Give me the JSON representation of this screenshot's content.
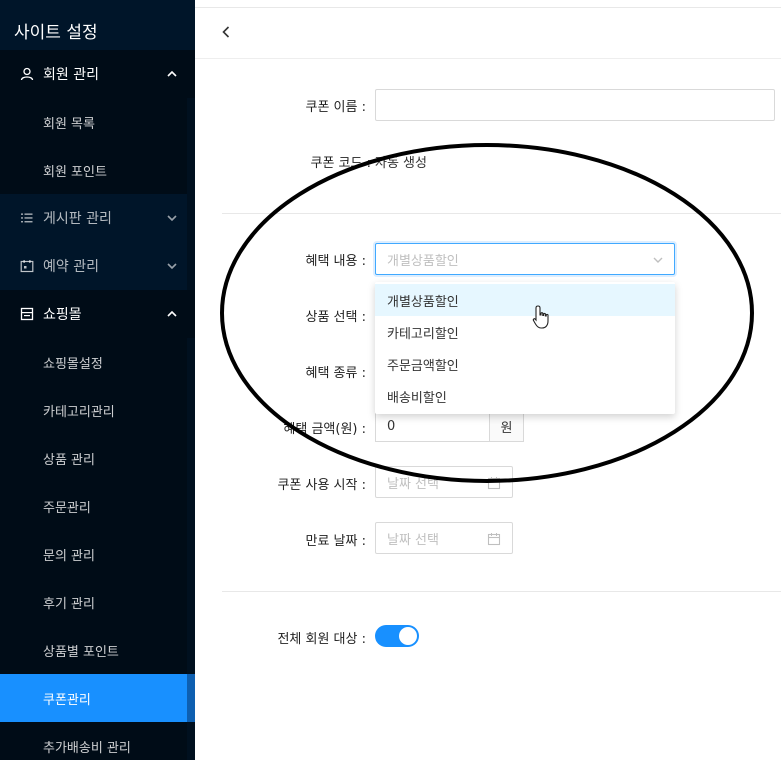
{
  "sidebar": {
    "title": "사이트 설정",
    "menus": [
      {
        "label": "회원 관리",
        "icon": "user-icon",
        "expanded": true
      },
      {
        "label": "회원 목록"
      },
      {
        "label": "회원 포인트"
      },
      {
        "label": "게시판 관리",
        "icon": "list-icon",
        "expanded": false
      },
      {
        "label": "예약 관리",
        "icon": "calendar-icon",
        "expanded": false
      },
      {
        "label": "쇼핑몰",
        "icon": "shop-icon",
        "expanded": true
      },
      {
        "label": "쇼핑몰설정"
      },
      {
        "label": "카테고리관리"
      },
      {
        "label": "상품 관리"
      },
      {
        "label": "주문관리"
      },
      {
        "label": "문의 관리"
      },
      {
        "label": "후기 관리"
      },
      {
        "label": "상품별 포인트"
      },
      {
        "label": "쿠폰관리",
        "active": true
      },
      {
        "label": "추가배송비 관리"
      }
    ]
  },
  "form": {
    "coupon_name_label": "쿠폰 이름",
    "coupon_name_value": "",
    "coupon_code_label": "쿠폰 코드",
    "coupon_code_value": "자동 생성",
    "benefit_label": "혜택 내용",
    "benefit_placeholder": "개별상품할인",
    "product_label": "상품 선택",
    "benefit_type_label": "혜택 종류",
    "amount_label": "혜택 금액(원)",
    "amount_value": "0",
    "amount_unit": "원",
    "start_label": "쿠폰 사용 시작",
    "start_placeholder": "날짜 선택",
    "end_label": "만료 날짜",
    "end_placeholder": "날짜 선택",
    "all_members_label": "전체 회원 대상",
    "all_members_on": true
  },
  "dropdown": {
    "options": [
      "개별상품할인",
      "카테고리할인",
      "주문금액할인",
      "배송비할인"
    ],
    "hovered_index": 0
  },
  "colors": {
    "sidebar_bg": "#001529",
    "submenu_bg": "#000c17",
    "accent": "#1890ff"
  }
}
